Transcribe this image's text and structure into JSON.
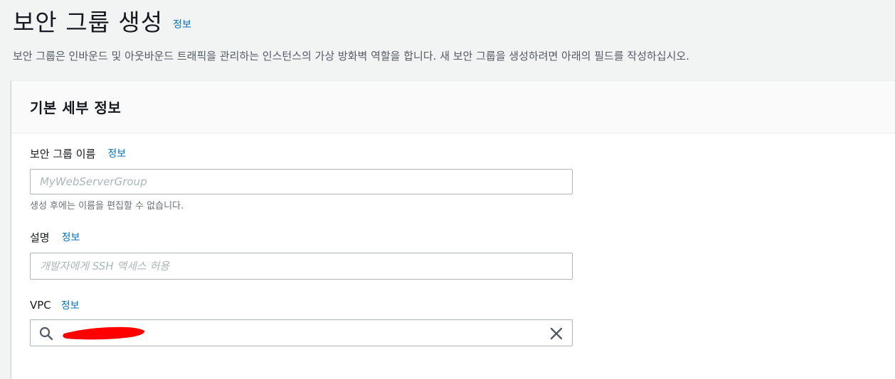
{
  "header": {
    "title": "보안 그룹 생성",
    "info": "정보",
    "description": "보안 그룹은 인바운드 및 아웃바운드 트래픽을 관리하는 인스턴스의 가상 방화벽 역할을 합니다. 새 보안 그룹을 생성하려면 아래의 필드를 작성하십시오."
  },
  "panel": {
    "title": "기본 세부 정보"
  },
  "fields": {
    "name": {
      "label": "보안 그룹 이름",
      "info": "정보",
      "placeholder": "MyWebServerGroup",
      "value": "",
      "constraint": "생성 후에는 이름을 편집할 수 없습니다."
    },
    "description": {
      "label": "설명",
      "info": "정보",
      "placeholder": "개발자에게 SSH 액세스 허용",
      "value": ""
    },
    "vpc": {
      "label": "VPC",
      "info": "정보",
      "value": ""
    }
  },
  "icons": {
    "search": "search-icon",
    "clear": "close-icon"
  },
  "colors": {
    "link": "#0073bb",
    "redaction": "#ff0000"
  }
}
